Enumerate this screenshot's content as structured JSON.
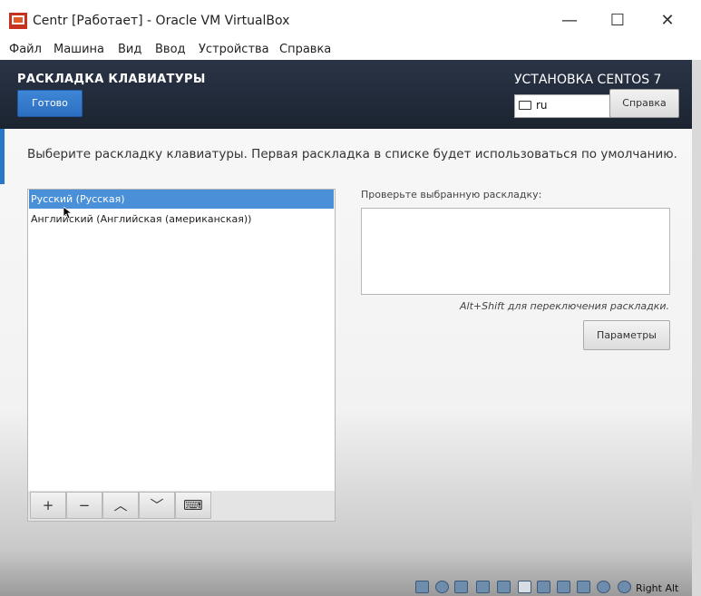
{
  "window": {
    "title": "Centr [Работает] - Oracle VM VirtualBox",
    "controls": [
      "—",
      "☐",
      "✕"
    ]
  },
  "menu": [
    "Файл",
    "Машина",
    "Вид",
    "Ввод",
    "Устройства",
    "Справка"
  ],
  "header": {
    "screen_title": "РАСКЛАДКА КЛАВИАТУРЫ",
    "done_label": "Готово",
    "install_title": "УСТАНОВКА CENTOS 7",
    "keyboard_value": "ru",
    "help_label": "Справка"
  },
  "content": {
    "instructions": "Выберите раскладку клавиатуры. Первая раскладка в списке будет использоваться по умолчанию.",
    "layouts": [
      {
        "label": "Русский (Русская)",
        "selected": true
      },
      {
        "label": "Английский (Английская (американская))",
        "selected": false
      }
    ],
    "toolbar": [
      "+",
      "−",
      "︿",
      "﹀",
      "⌨"
    ],
    "test_label": "Проверьте выбранную раскладку:",
    "switch_hint": "Alt+Shift для переключения раскладки.",
    "options_label": "Параметры"
  },
  "status": {
    "host_key": "Right Alt"
  },
  "colors": {
    "header_bg": "#1f2836",
    "accent": "#2a76c9",
    "selection": "#4a90d9",
    "done_button": "#3579cc"
  }
}
